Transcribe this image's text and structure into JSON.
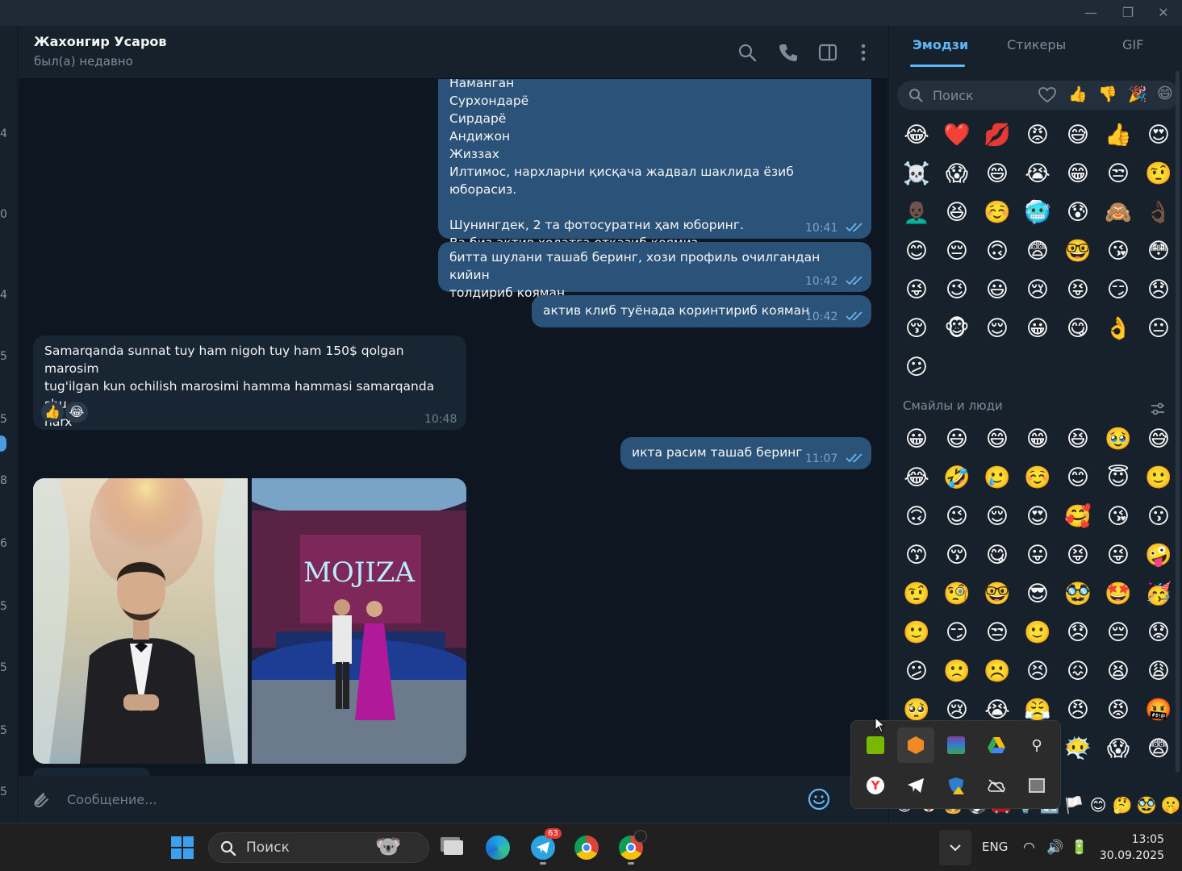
{
  "chat": {
    "name": "Жахонгир Усаров",
    "status": "был(а) недавно",
    "composer_placeholder": "Сообщение..."
  },
  "left_strip": [
    "4",
    "0",
    "4",
    "5",
    "5",
    "8",
    "6",
    "5",
    "5",
    "5",
    "5"
  ],
  "messages": [
    {
      "lines": [
        "Наманган",
        "Сурхондарё",
        "Сирдарё",
        "Андижон",
        "Жиззах",
        "Илтимос, нархларни қисқача жадвал шаклида ёзиб юборасиз.",
        "",
        "Шунингдек, 2 та фотосуратни ҳам юборинг.",
        "Ва биз актив холатга отказиб коямиз"
      ],
      "time": "10:41"
    },
    {
      "lines": [
        "битта шулани ташаб беринг, хози профиль очилгандан кийин",
        "толдириб кояман"
      ],
      "time": "10:42"
    },
    {
      "lines": [
        "актив клиб туёнада коринтириб кояман"
      ],
      "time": "10:42"
    },
    {
      "lines": [
        "Samarqanda sunnat tuy ham nigoh tuy ham 150$ qolgan marosim",
        "tug'ilgan kun ochilish marosimi hamma hammasi samarqanda shu",
        "narx"
      ],
      "time": "10:48",
      "reactions": [
        "👍",
        "😂"
      ]
    },
    {
      "lines": [
        "икта расим ташаб беринг"
      ],
      "time": "11:07"
    }
  ],
  "photo2_sign": "MOJIZA",
  "emoji_panel": {
    "tabs": [
      "Эмодзи",
      "Стикеры",
      "GIF"
    ],
    "search_placeholder": "Поиск",
    "recent": [
      "😂",
      "❤️",
      "💋",
      "😡",
      "😅",
      "👍",
      "😍",
      "☠️",
      "😱",
      "😄",
      "😭",
      "😁",
      "😒",
      "🤨",
      "👨🏿‍🦲",
      "😆",
      "☺️",
      "🥶",
      "😰",
      "🙈",
      "👌🏿",
      "😊",
      "😔",
      "🙃",
      "😨",
      "🤓",
      "😘",
      "😳",
      "😜",
      "😉",
      "😃",
      "😢",
      "😝",
      "😏",
      "😞",
      "😚",
      "🐵",
      "😌",
      "😀",
      "😋",
      "👌",
      "😐",
      "😕"
    ],
    "section_title": "Смайлы и люди",
    "people": [
      "😀",
      "😃",
      "😄",
      "😁",
      "😆",
      "🥹",
      "😅",
      "😂",
      "🤣",
      "🥲",
      "☺️",
      "😊",
      "😇",
      "🙂",
      "🙃",
      "😉",
      "😌",
      "😍",
      "🥰",
      "😘",
      "😗",
      "😙",
      "😚",
      "😋",
      "😛",
      "😝",
      "😜",
      "🤪",
      "🤨",
      "🧐",
      "🤓",
      "😎",
      "🥸",
      "🤩",
      "🥳",
      "🙂",
      "😏",
      "😒",
      "🙂",
      "😞",
      "😔",
      "😟",
      "😕",
      "🙁",
      "☹️",
      "😣",
      "😖",
      "😫",
      "😩",
      "🥺",
      "😢",
      "😭",
      "😤",
      "😠",
      "😡",
      "🤬",
      "🤯",
      "😳",
      "🥵",
      "🥶",
      "😶‍🌫️",
      "😱",
      "😨"
    ],
    "bottom_row": [
      "😃",
      "🐶",
      "🍔",
      "⚽",
      "🚗",
      "💡",
      "🔣",
      "🏳️",
      "😊",
      "🤔",
      "🥸",
      "🤫"
    ]
  },
  "tray": {
    "items": [
      "nvidia",
      "app-orange",
      "winrar",
      "google-drive",
      "usb",
      "yandex",
      "telegram",
      "defender-warning",
      "onedrive",
      "monitor"
    ]
  },
  "taskbar": {
    "search_label": "Поиск",
    "telegram_badge": "63",
    "lang": "ENG",
    "time": "13:05",
    "date": "30.09.2025"
  }
}
